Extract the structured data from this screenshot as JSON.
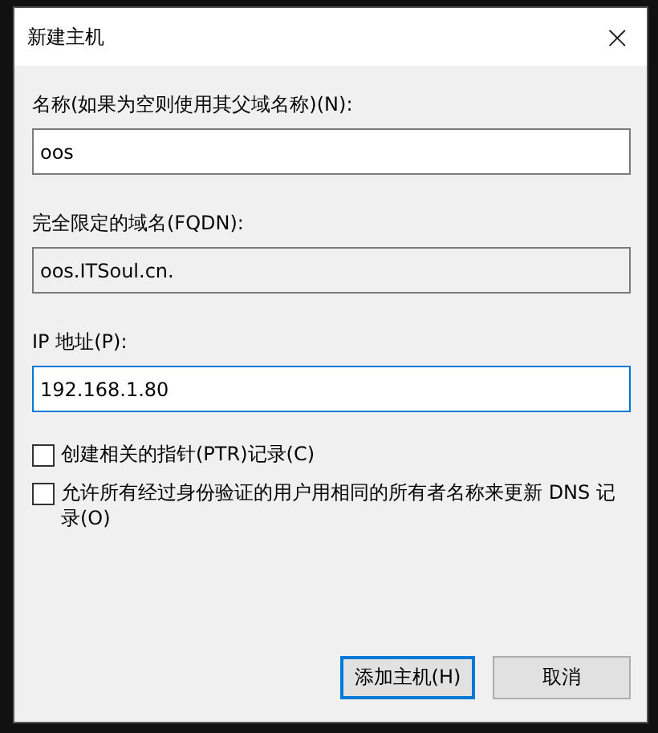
{
  "window": {
    "title": "新建主机",
    "close": "×"
  },
  "fields": [
    {
      "label": "名称(如果为空则使用其父域名称)(N):",
      "value": "oos",
      "readonly": false,
      "focused": false
    },
    {
      "label": "完全限定的域名(FQDN):",
      "value": "oos.ITSoul.cn.",
      "readonly": true,
      "focused": false
    },
    {
      "label": "IP 地址(P):",
      "value": "192.168.1.80",
      "readonly": false,
      "focused": true
    }
  ],
  "checkboxes": [
    {
      "label": "创建相关的指针(PTR)记录(C)",
      "checked": false
    },
    {
      "label": "允许所有经过身份验证的用户用相同的所有者名称来更新 DNS 记录(O)",
      "checked": false
    }
  ],
  "buttons": [
    {
      "label": "添加主机(H)",
      "default": true
    },
    {
      "label": "取消",
      "default": false
    }
  ]
}
